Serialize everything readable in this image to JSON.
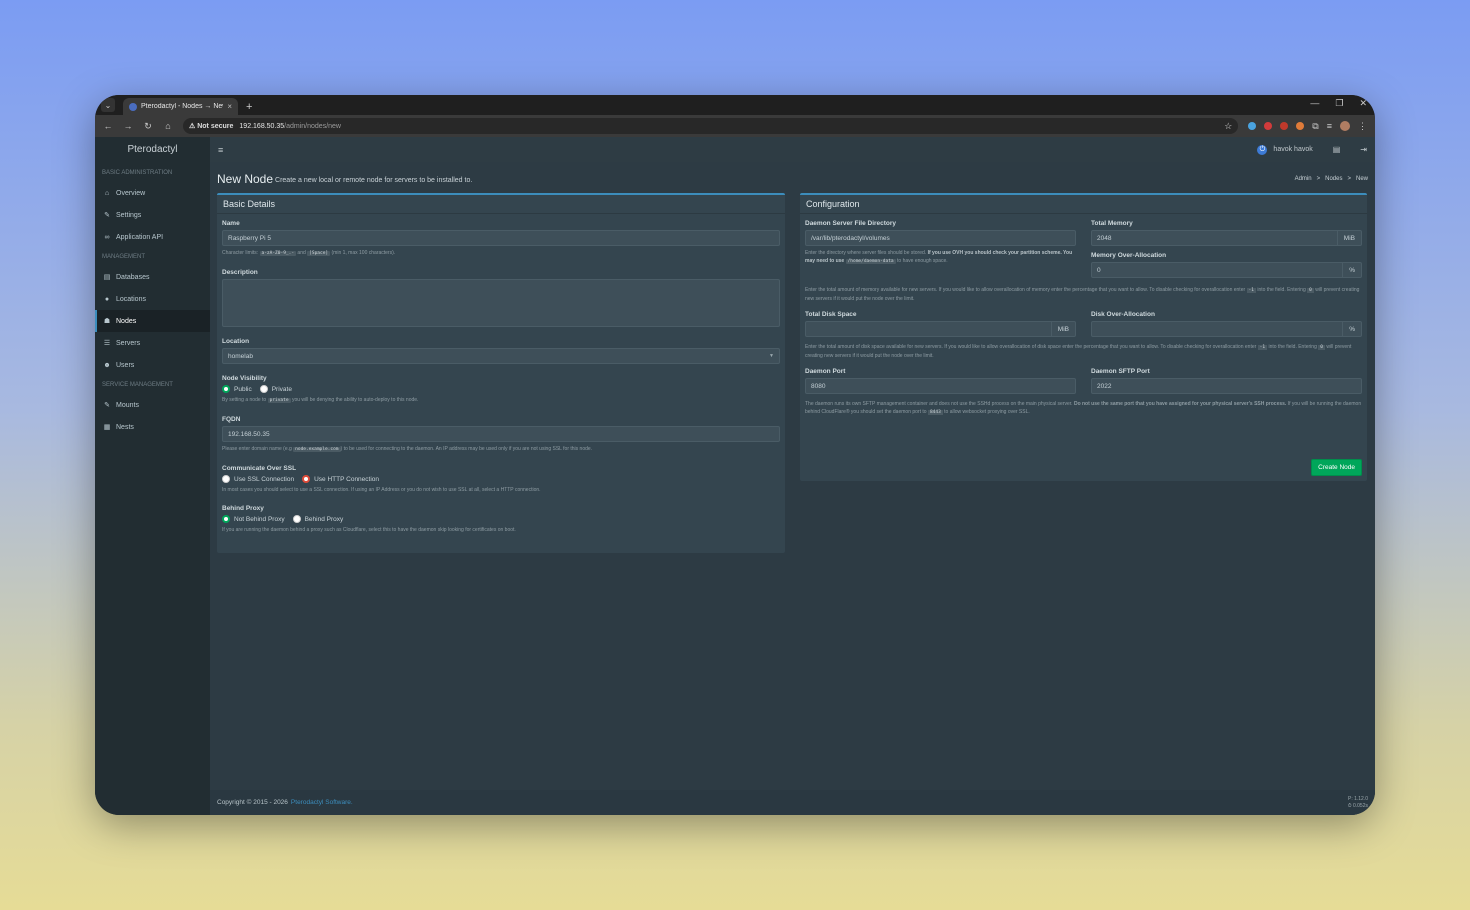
{
  "browser": {
    "tab_title": "Pterodactyl - Nodes → New",
    "tab_close": "×",
    "new_tab": "+",
    "not_secure": "⚠ Not secure",
    "url_host": "192.168.50.35",
    "url_path": "/admin/nodes/new"
  },
  "app": {
    "brand": "Pterodactyl"
  },
  "navbar": {
    "user_name": "havok havok"
  },
  "sidebar": {
    "sections": [
      {
        "header": "BASIC ADMINISTRATION",
        "items": [
          "Overview",
          "Settings",
          "Application API"
        ]
      },
      {
        "header": "MANAGEMENT",
        "items": [
          "Databases",
          "Locations",
          "Nodes",
          "Servers",
          "Users"
        ]
      },
      {
        "header": "SERVICE MANAGEMENT",
        "items": [
          "Mounts",
          "Nests"
        ]
      }
    ]
  },
  "page": {
    "title": "New Node",
    "subtitle": "Create a new local or remote node for servers to be installed to.",
    "breadcrumbs": [
      "Admin",
      ">",
      "Nodes",
      ">",
      "New"
    ]
  },
  "basic": {
    "title": "Basic Details",
    "name_label": "Name",
    "name_value": "Raspberry Pi 5",
    "name_help_1": "Character limits:",
    "name_help_code1": "a-zA-Z0-9_.-",
    "name_help_2": "and",
    "name_help_code2": "[Space]",
    "name_help_3": "(min 1, max 100 characters).",
    "desc_label": "Description",
    "location_label": "Location",
    "location_value": "homelab",
    "visibility_label": "Node Visibility",
    "public": "Public",
    "private": "Private",
    "vis_help_1": "By setting a node to",
    "vis_help_code": "private",
    "vis_help_2": "you will be denying the ability to auto-deploy to this node.",
    "fqdn_label": "FQDN",
    "fqdn_value": "192.168.50.35",
    "fqdn_help_1": "Please enter domain name (e.g",
    "fqdn_help_code": "node.example.com",
    "fqdn_help_2": ") to be used for connecting to the daemon. An IP address may be used only if you are not using SSL for this node.",
    "ssl_label": "Communicate Over SSL",
    "use_ssl": "Use SSL Connection",
    "use_http": "Use HTTP Connection",
    "ssl_help": "In most cases you should select to use a SSL connection. If using an IP Address or you do not wish to use SSL at all, select a HTTP connection.",
    "proxy_label": "Behind Proxy",
    "not_behind": "Not Behind Proxy",
    "behind": "Behind Proxy",
    "proxy_help": "If you are running the daemon behind a proxy such as Cloudflare, select this to have the daemon skip looking for certificates on boot."
  },
  "config": {
    "title": "Configuration",
    "dir_label": "Daemon Server File Directory",
    "dir_value": "/var/lib/pterodactyl/volumes",
    "dir_help_1": "Enter the directory where server files should be stored.",
    "dir_help_bold": "If you use OVH you should check your partition scheme. You may need to use",
    "dir_help_code": "/home/daemon-data",
    "dir_help_2": "to have enough space.",
    "mem_label": "Total Memory",
    "mem_value": "2048",
    "mem_unit": "MiB",
    "mem_over_label": "Memory Over-Allocation",
    "mem_over_value": "0",
    "pct": "%",
    "mem_help_1": "Enter the total amount of memory available for new servers. If you would like to allow overallocation of memory enter the percentage that you want to allow. To disable checking for overallocation enter",
    "mem_help_code1": "-1",
    "mem_help_2": "into the field. Entering",
    "mem_help_code2": "0",
    "mem_help_3": "will prevent creating new servers if it would put the node over the limit.",
    "disk_label": "Total Disk Space",
    "disk_value": "",
    "disk_unit": "MiB",
    "disk_over_label": "Disk Over-Allocation",
    "disk_over_value": "",
    "disk_help_1": "Enter the total amount of disk space available for new servers. If you would like to allow overallocation of disk space enter the percentage that you want to allow. To disable checking for overallocation enter",
    "disk_help_code1": "-1",
    "disk_help_2": "into the field. Entering",
    "disk_help_code2": "0",
    "disk_help_3": "will prevent creating new servers if it would put the node over the limit.",
    "port_label": "Daemon Port",
    "port_value": "8080",
    "sftp_label": "Daemon SFTP Port",
    "sftp_value": "2022",
    "port_help_1": "The daemon runs its own SFTP management container and does not use the SSHd process on the main physical server.",
    "port_help_bold": "Do not use the same port that you have assigned for your physical server's SSH process.",
    "port_help_2": "If you will be running the daemon behind CloudFlare® you should set the daemon port to",
    "port_help_code": "8443",
    "port_help_3": "to allow websocket proxying over SSL.",
    "create_button": "Create Node"
  },
  "footer": {
    "copyright": "Copyright © 2015 - 2026",
    "link": "Pterodactyl Software.",
    "version": "P: 1.12.0",
    "time": "⏱ 0.052s"
  }
}
